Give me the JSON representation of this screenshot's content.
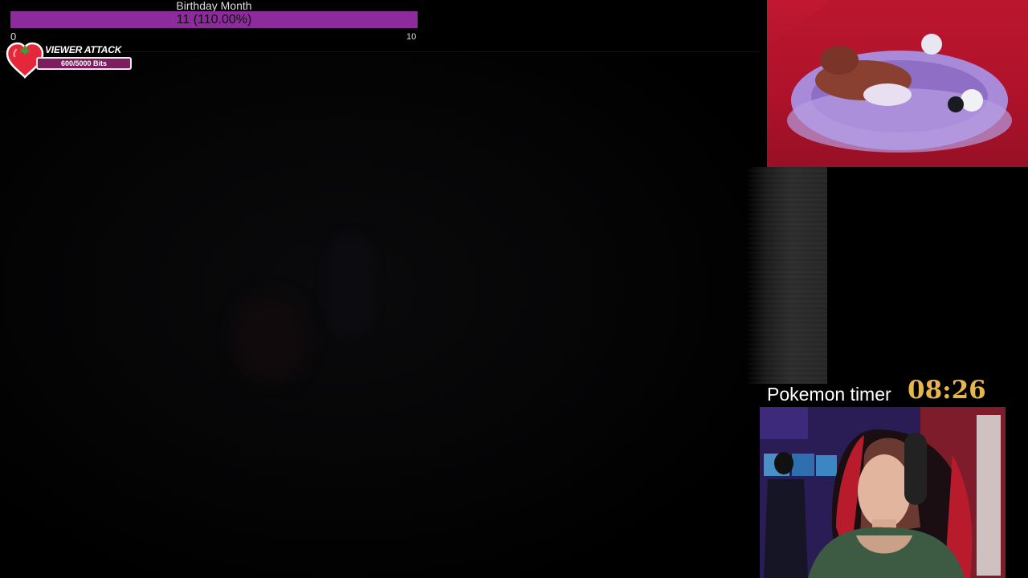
{
  "goal": {
    "title": "Birthday Month",
    "value_text": "11 (110.00%)",
    "min_label": "0",
    "max_label": "10",
    "progress_fraction": 1.1,
    "bar_color": "#8d2a9c"
  },
  "viewer_attack": {
    "title": "VIEWER ATTACK",
    "progress_text": "600/5000 Bits",
    "progress_fraction": 0.12,
    "icon": "tomato-heart-icon",
    "accent_color": "#7b1d5e"
  },
  "timer": {
    "label": "Pokemon timer",
    "value": "08:26",
    "value_color": "#e6b54e"
  },
  "cameras": {
    "pet_cam_icon": "pet-camera-feed",
    "face_cam_icon": "webcam-feed"
  }
}
